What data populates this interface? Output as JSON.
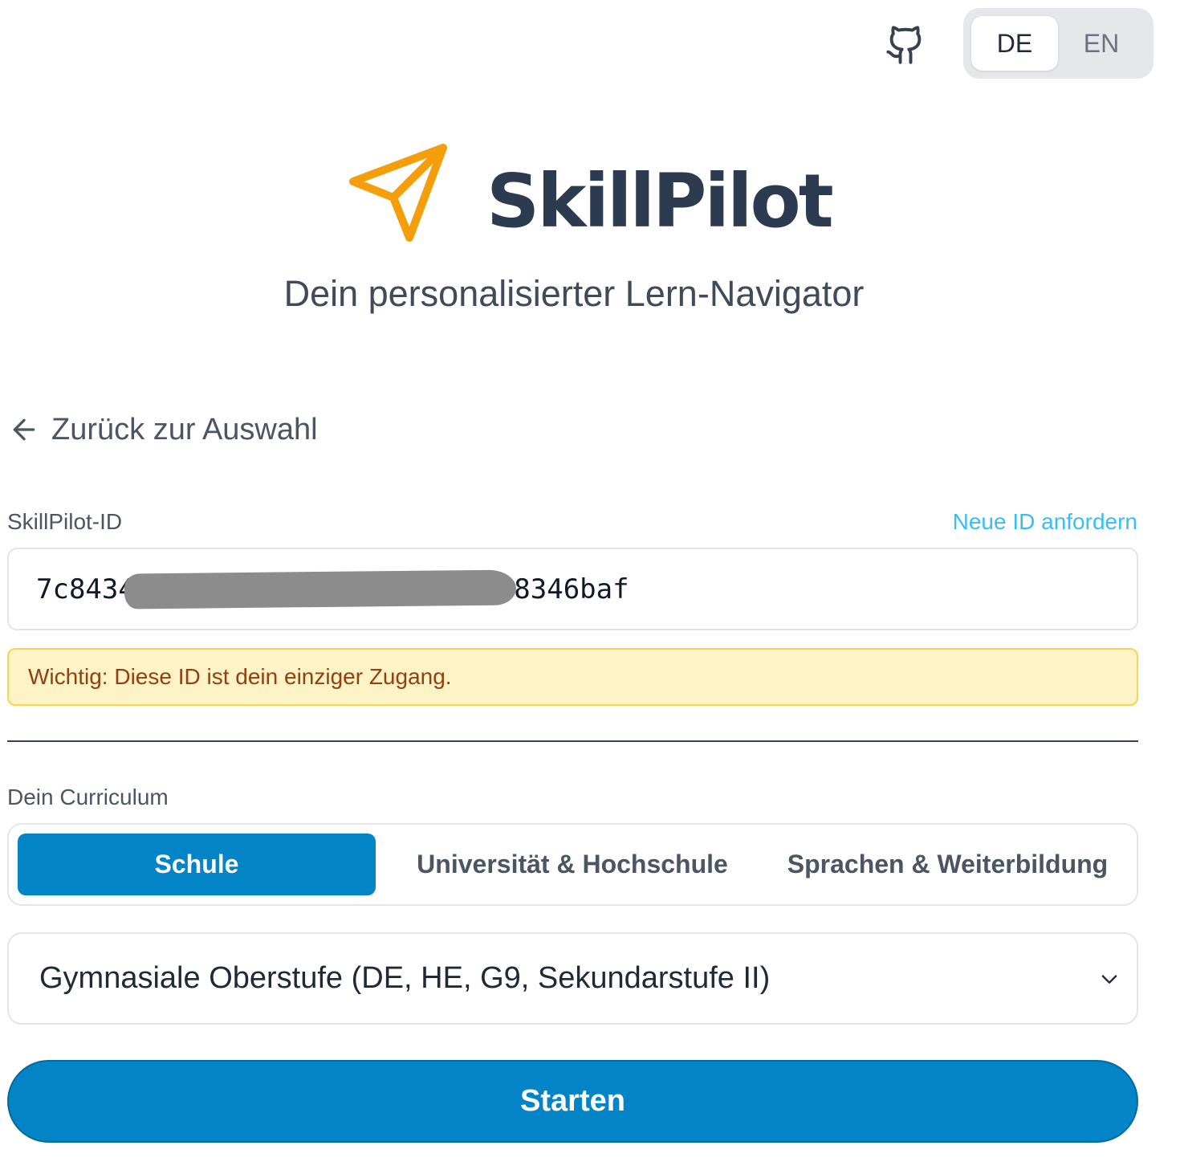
{
  "header": {
    "github_icon": "github-icon",
    "languages": [
      {
        "label": "DE",
        "active": true
      },
      {
        "label": "EN",
        "active": false
      }
    ]
  },
  "brand": {
    "name": "SkillPilot",
    "tagline": "Dein personalisierter Lern-Navigator",
    "logo_icon": "paper-plane-icon",
    "logo_color": "#f59e0b"
  },
  "back_link": {
    "label": "Zurück zur Auswahl",
    "icon": "arrow-left-icon"
  },
  "id_section": {
    "label": "SkillPilot-ID",
    "new_id_link": "Neue ID anfordern",
    "value_visible_start": "7c8434",
    "value_visible_end": "18346baf",
    "warning": "Wichtig: Diese ID ist dein einziger Zugang."
  },
  "curriculum": {
    "label": "Dein Curriculum",
    "tabs": [
      {
        "label": "Schule",
        "active": true
      },
      {
        "label": "Universität & Hochschule",
        "active": false
      },
      {
        "label": "Sprachen & Weiterbildung",
        "active": false
      }
    ],
    "selected": "Gymnasiale Oberstufe (DE, HE, G9, Sekundarstufe II)"
  },
  "start_button": "Starten",
  "colors": {
    "primary": "#0284c7",
    "link": "#38bdf8",
    "warning_bg": "#fef3c7",
    "warning_text": "#92400e",
    "brand_text": "#2d3b51"
  }
}
